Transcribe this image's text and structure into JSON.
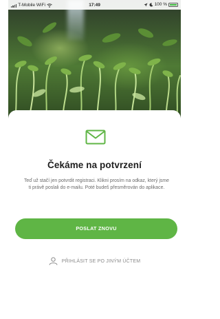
{
  "status_bar": {
    "carrier": "T-Mobile WiFi",
    "time": "17:49",
    "battery": "100 %",
    "icons": [
      "signal-icon",
      "wifi-icon",
      "location-icon",
      "moon-icon",
      "battery-icon"
    ]
  },
  "hero": {
    "image": "sprouts-photo"
  },
  "card": {
    "icon": "mail-icon",
    "title": "Čekáme na potvrzení",
    "description": "Teď už stačí jen potvrdit registraci. Klikni prosím na odkaz, který jsme ti právě poslali do e-mailu. Poté budeš přesměrován do aplikace.",
    "resend_label": "POSLAT ZNOVU",
    "other_account_label": "PŘIHLÁSIT SE PO JINÝM ÚČTEM",
    "other_account_icon": "user-icon"
  },
  "colors": {
    "accent": "#5fb545",
    "title_text": "#1e1e1e",
    "body_text": "#6a6a6a",
    "muted_text": "#8a8a8a"
  }
}
